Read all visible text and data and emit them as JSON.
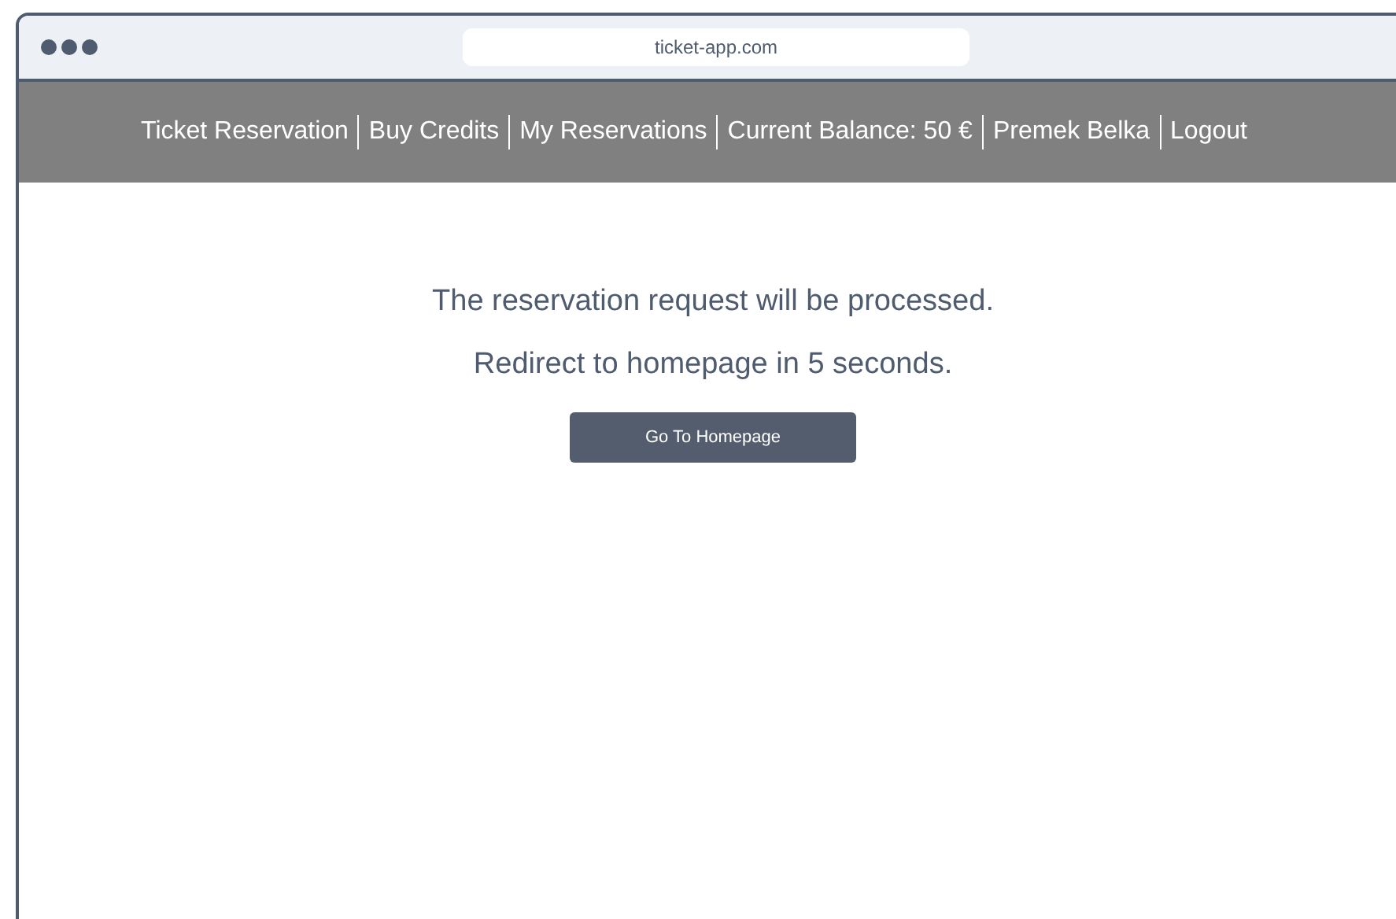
{
  "browser": {
    "url": "ticket-app.com"
  },
  "nav": {
    "items": [
      {
        "label": "Ticket Reservation"
      },
      {
        "label": "Buy Credits"
      },
      {
        "label": "My Reservations"
      },
      {
        "label": "Current Balance: 50 €"
      },
      {
        "label": "Premek Belka"
      },
      {
        "label": "Logout"
      }
    ]
  },
  "message": {
    "lines": [
      "The reservation request will be processed.",
      "Redirect to homepage in 5 seconds."
    ],
    "button": "Go To Homepage"
  }
}
